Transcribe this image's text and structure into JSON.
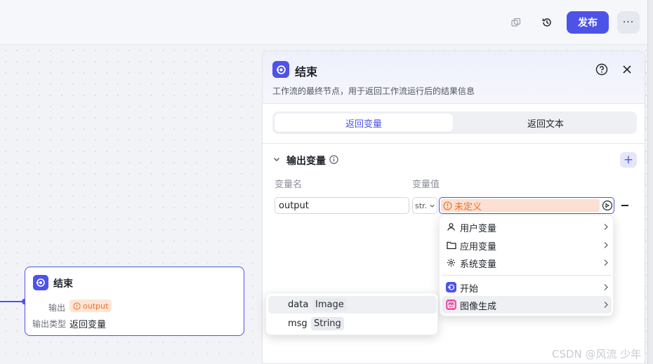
{
  "topbar": {
    "copy_icon": "copy-icon",
    "history_icon": "history-icon",
    "publish_label": "发布",
    "more_label": "···"
  },
  "node": {
    "title": "结束",
    "output_label": "输出",
    "output_tag": "output",
    "output_type_label": "输出类型",
    "output_type_value": "返回变量"
  },
  "panel": {
    "title": "结束",
    "description": "工作流的最终节点，用于返回工作流运行后的结果信息",
    "tabs": [
      {
        "label": "返回变量",
        "active": true
      },
      {
        "label": "返回文本",
        "active": false
      }
    ],
    "section_title": "输出变量",
    "columns": {
      "name": "变量名",
      "value": "变量值"
    },
    "row": {
      "name_value": "output",
      "type_value": "str.",
      "value_tag": "未定义"
    }
  },
  "menu": {
    "items": [
      {
        "label": "用户变量",
        "icon": "user-icon"
      },
      {
        "label": "应用变量",
        "icon": "folder-icon"
      },
      {
        "label": "系统变量",
        "icon": "gear-icon"
      },
      {
        "label": "开始",
        "icon": "start-node-icon"
      },
      {
        "label": "图像生成",
        "icon": "image-generate-icon"
      }
    ]
  },
  "submenu": {
    "items": [
      {
        "name": "data",
        "type": "Image"
      },
      {
        "name": "msg",
        "type": "String"
      }
    ]
  },
  "watermark": "CSDN @风流 少年",
  "colors": {
    "accent": "#4d53e8",
    "warning": "#f0701f",
    "warning_bg": "#fbe0d3"
  }
}
